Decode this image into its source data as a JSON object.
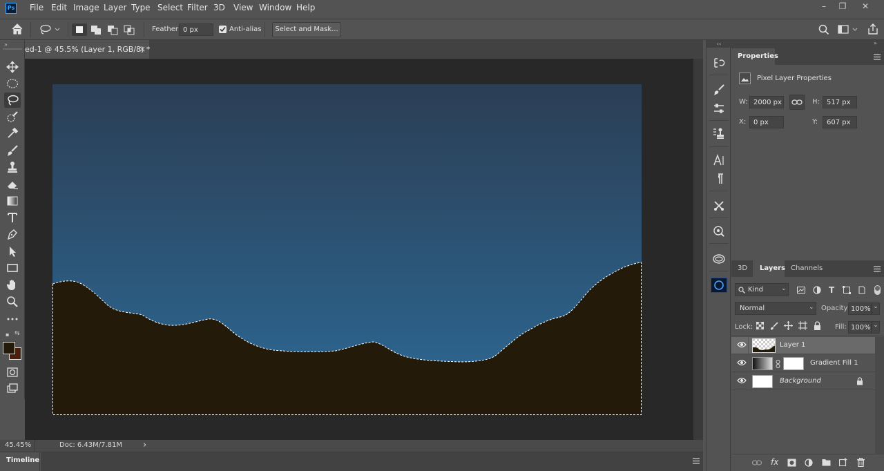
{
  "app": {
    "logo": "Ps"
  },
  "menu": [
    "File",
    "Edit",
    "Image",
    "Layer",
    "Type",
    "Select",
    "Filter",
    "3D",
    "View",
    "Window",
    "Help"
  ],
  "window_controls": {
    "minimize": "–",
    "restore": "❐",
    "close": "✕"
  },
  "options": {
    "feather_label": "Feather:",
    "feather_value": "0 px",
    "antialias_label": "Anti-alias",
    "antialias_checked": true,
    "select_mask_label": "Select and Mask..."
  },
  "document": {
    "tab_title": "ed-1 @ 45.5% (Layer 1, RGB/8) *",
    "close": "×",
    "sky_top_color": "#2b3e54",
    "sky_bottom_color": "#2d6a97",
    "ground_color": "#231a0a"
  },
  "status": {
    "zoom": "45.45%",
    "doc": "Doc: 6.43M/7.81M",
    "arrow": "›"
  },
  "timeline": {
    "label": "Timeline"
  },
  "colors": {
    "foreground": "#231a0a",
    "background": "#4a1f0b"
  },
  "properties": {
    "tab": "Properties",
    "section_title": "Pixel Layer Properties",
    "w_label": "W:",
    "w_value": "2000 px",
    "h_label": "H:",
    "h_value": "517 px",
    "x_label": "X:",
    "x_value": "0 px",
    "y_label": "Y:",
    "y_value": "607 px"
  },
  "layers_panel": {
    "tabs": [
      "3D",
      "Layers",
      "Channels"
    ],
    "active_tab": "Layers",
    "filter_kind": "Kind",
    "blend_mode": "Normal",
    "opacity_label": "Opacity:",
    "opacity_value": "100%",
    "lock_label": "Lock:",
    "fill_label": "Fill:",
    "fill_value": "100%",
    "layers": [
      {
        "name": "Layer 1",
        "selected": true
      },
      {
        "name": "Gradient Fill 1",
        "selected": false
      },
      {
        "name": "Background",
        "selected": false,
        "locked": true
      }
    ]
  }
}
